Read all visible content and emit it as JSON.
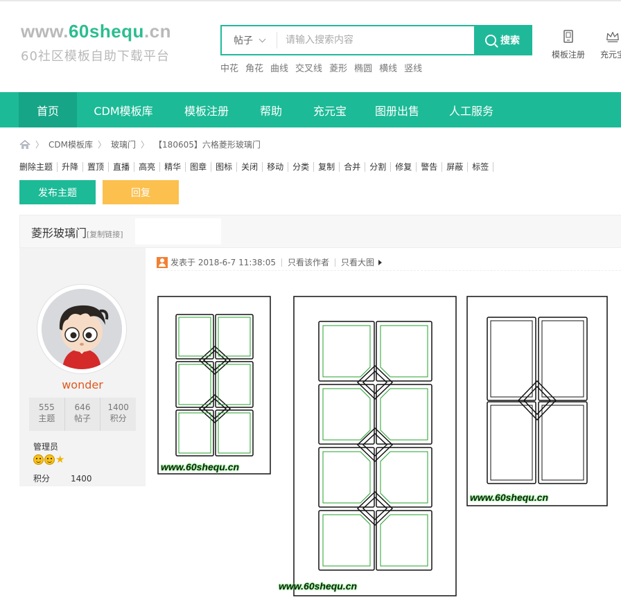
{
  "logo": {
    "url_pre": "www.",
    "url_accent": "60shequ",
    "url_post": ".cn",
    "tagline": "60社区模板自助下载平台"
  },
  "search": {
    "type_label": "帖子",
    "placeholder": "请输入搜索内容",
    "button_label": "搜索"
  },
  "hot_keywords": [
    "中花",
    "角花",
    "曲线",
    "交叉线",
    "菱形",
    "椭圆",
    "横线",
    "竖线"
  ],
  "quick_links": [
    {
      "label": "模板注册",
      "icon": "tablet-icon"
    },
    {
      "label": "充元宝",
      "icon": "crown-icon"
    }
  ],
  "nav": [
    {
      "label": "首页",
      "active": true
    },
    {
      "label": "CDM模板库"
    },
    {
      "label": "模板注册"
    },
    {
      "label": "帮助"
    },
    {
      "label": "充元宝"
    },
    {
      "label": "图册出售"
    },
    {
      "label": "人工服务"
    }
  ],
  "breadcrumb": [
    "CDM模板库",
    "玻璃门",
    "【180605】六格菱形玻璃门"
  ],
  "admin_actions": [
    "删除主题",
    "升降",
    "置顶",
    "直播",
    "高亮",
    "精华",
    "图章",
    "图标",
    "关闭",
    "移动",
    "分类",
    "复制",
    "合并",
    "分割",
    "修复",
    "警告",
    "屏蔽",
    "标签"
  ],
  "buttons": {
    "post": "发布主题",
    "reply": "回复"
  },
  "thread": {
    "title": "菱形玻璃门",
    "copy_link": "[复制链接]"
  },
  "author": {
    "name": "wonder",
    "stats": [
      {
        "value": "555",
        "label": "主题"
      },
      {
        "value": "646",
        "label": "帖子"
      },
      {
        "value": "1400",
        "label": "积分"
      }
    ],
    "role": "管理员",
    "points_label": "积分",
    "points_value": "1400"
  },
  "post": {
    "posted": "发表于 2018-6-7 11:38:05",
    "author_only": "只看该作者",
    "big_image": "只看大图"
  },
  "watermark": "www.60shequ.cn",
  "colors": {
    "brand": "#1dba97",
    "reply": "#fcc04f",
    "username": "#e0581e",
    "glass_line": "#22a02a"
  }
}
